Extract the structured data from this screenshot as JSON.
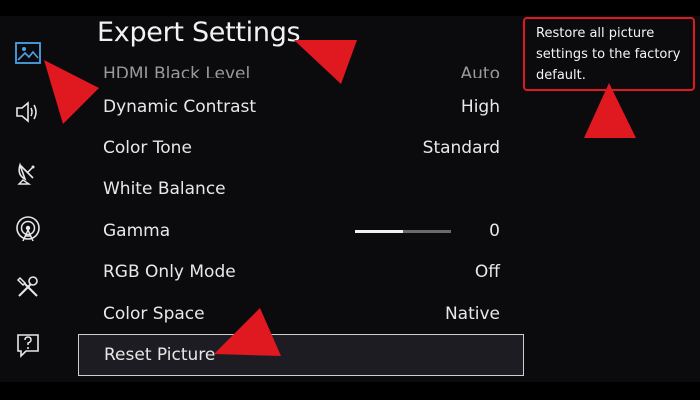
{
  "window": {
    "title": "Expert Settings"
  },
  "sidebar": {
    "items": [
      {
        "name": "picture",
        "icon": "picture-icon"
      },
      {
        "name": "sound",
        "icon": "speaker-icon"
      },
      {
        "name": "broadcasting",
        "icon": "satellite-dish-icon"
      },
      {
        "name": "network",
        "icon": "network-icon"
      },
      {
        "name": "general",
        "icon": "tools-icon"
      },
      {
        "name": "support",
        "icon": "help-icon"
      }
    ]
  },
  "menu": {
    "items": [
      {
        "label": "HDMI Black Level",
        "value": "Auto"
      },
      {
        "label": "Dynamic Contrast",
        "value": "High"
      },
      {
        "label": "Color Tone",
        "value": "Standard"
      },
      {
        "label": "White Balance",
        "value": ""
      },
      {
        "label": "Gamma",
        "value": "0",
        "slider_fill": 0.5
      },
      {
        "label": "RGB Only Mode",
        "value": "Off"
      },
      {
        "label": "Color Space",
        "value": "Native"
      },
      {
        "label": "Reset Picture",
        "value": ""
      }
    ],
    "selected_index": 7
  },
  "tooltip": {
    "text": "Restore all picture settings to the factory default."
  },
  "colors": {
    "annotation": "#e0181f",
    "accent": "#4aa3e8",
    "text": "#e8e8e8"
  }
}
